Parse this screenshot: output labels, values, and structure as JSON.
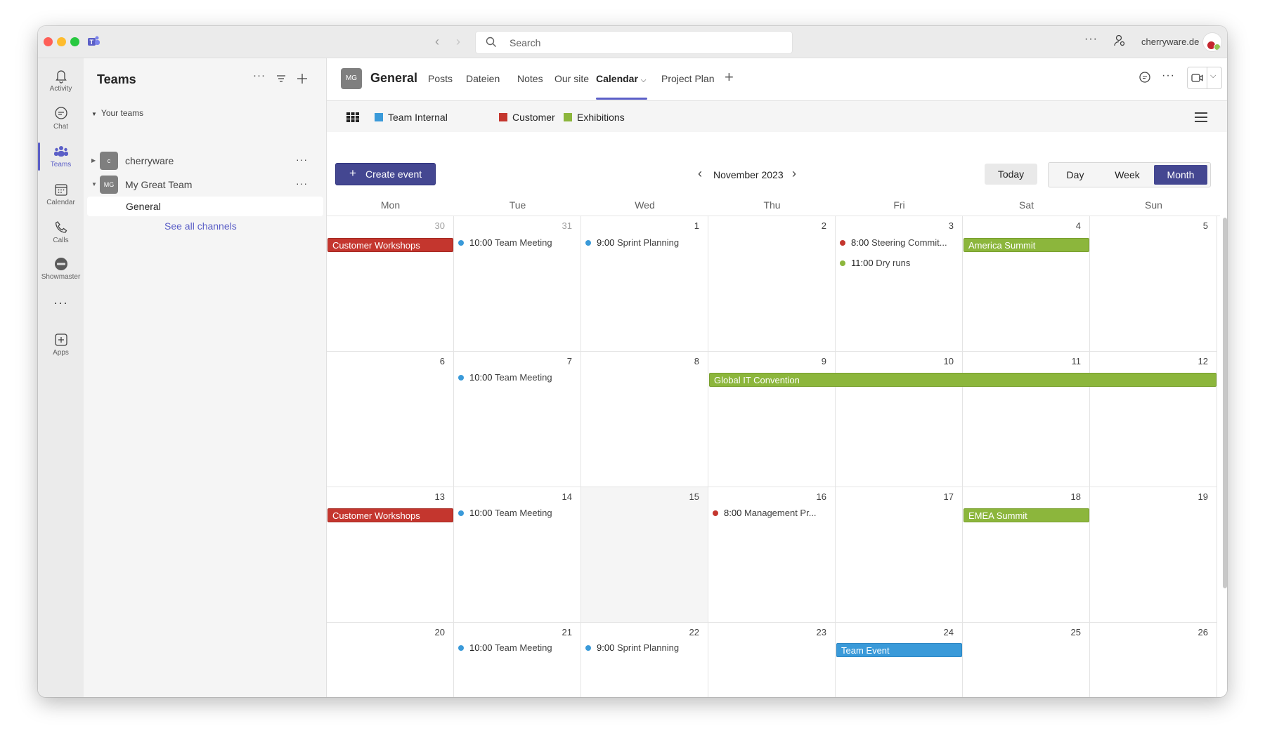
{
  "app": {
    "search_placeholder": "Search",
    "org": "cherryware.de",
    "window_dots": "···"
  },
  "rail": [
    {
      "label": "Activity",
      "icon": "bell-icon"
    },
    {
      "label": "Chat",
      "icon": "chat-icon"
    },
    {
      "label": "Teams",
      "icon": "teams-icon",
      "active": true
    },
    {
      "label": "Calendar",
      "icon": "calendar-icon"
    },
    {
      "label": "Calls",
      "icon": "phone-icon"
    },
    {
      "label": "Showmaster",
      "icon": "showmaster-icon"
    },
    {
      "label": "Apps",
      "icon": "apps-icon"
    }
  ],
  "panel": {
    "title": "Teams",
    "section": "Your teams",
    "teams": [
      {
        "avatar": "c",
        "name": "cherryware"
      },
      {
        "avatar": "MG",
        "name": "My Great Team"
      }
    ],
    "channel": "General",
    "see_all": "See all channels"
  },
  "channel": {
    "avatar": "MG",
    "name": "General",
    "tabs": [
      "Posts",
      "Dateien",
      "Notes",
      "Our site",
      "Calendar",
      "Project Plan"
    ],
    "active_tab": "Calendar"
  },
  "legend": [
    {
      "label": "Team Internal",
      "color": "#3a9ad9"
    },
    {
      "label": "Customer",
      "color": "#c4362e"
    },
    {
      "label": "Exhibitions",
      "color": "#8cb63c"
    }
  ],
  "toolbar": {
    "create_label": "Create event",
    "month_label": "November 2023",
    "today_label": "Today",
    "views": [
      "Day",
      "Week",
      "Month"
    ],
    "active_view": "Month"
  },
  "calendar": {
    "weekdays": [
      "Mon",
      "Tue",
      "Wed",
      "Thu",
      "Fri",
      "Sat",
      "Sun"
    ],
    "weeks": [
      [
        "30",
        "31",
        "1",
        "2",
        "3",
        "4",
        "5"
      ],
      [
        "6",
        "7",
        "8",
        "9",
        "10",
        "11",
        "12"
      ],
      [
        "13",
        "14",
        "15",
        "16",
        "17",
        "18",
        "19"
      ],
      [
        "20",
        "21",
        "22",
        "23",
        "24",
        "25",
        "26"
      ]
    ],
    "events": {
      "customer_workshops_1": "Customer Workshops",
      "team_meeting_1": {
        "time": "10:00",
        "title": "Team Meeting"
      },
      "sprint_planning_1": {
        "time": "9:00",
        "title": "Sprint Planning"
      },
      "steering": {
        "time": "8:00",
        "title": "Steering Commit..."
      },
      "dry_runs": {
        "time": "11:00",
        "title": "Dry runs"
      },
      "america_summit": "America Summit",
      "team_meeting_2": {
        "time": "10:00",
        "title": "Team Meeting"
      },
      "global_it": "Global IT Convention",
      "customer_workshops_2": "Customer Workshops",
      "team_meeting_3": {
        "time": "10:00",
        "title": "Team Meeting"
      },
      "management": {
        "time": "8:00",
        "title": "Management Pr..."
      },
      "emea_summit": "EMEA Summit",
      "team_meeting_4": {
        "time": "10:00",
        "title": "Team Meeting"
      },
      "sprint_planning_2": {
        "time": "9:00",
        "title": "Sprint Planning"
      },
      "team_event": "Team Event"
    }
  }
}
